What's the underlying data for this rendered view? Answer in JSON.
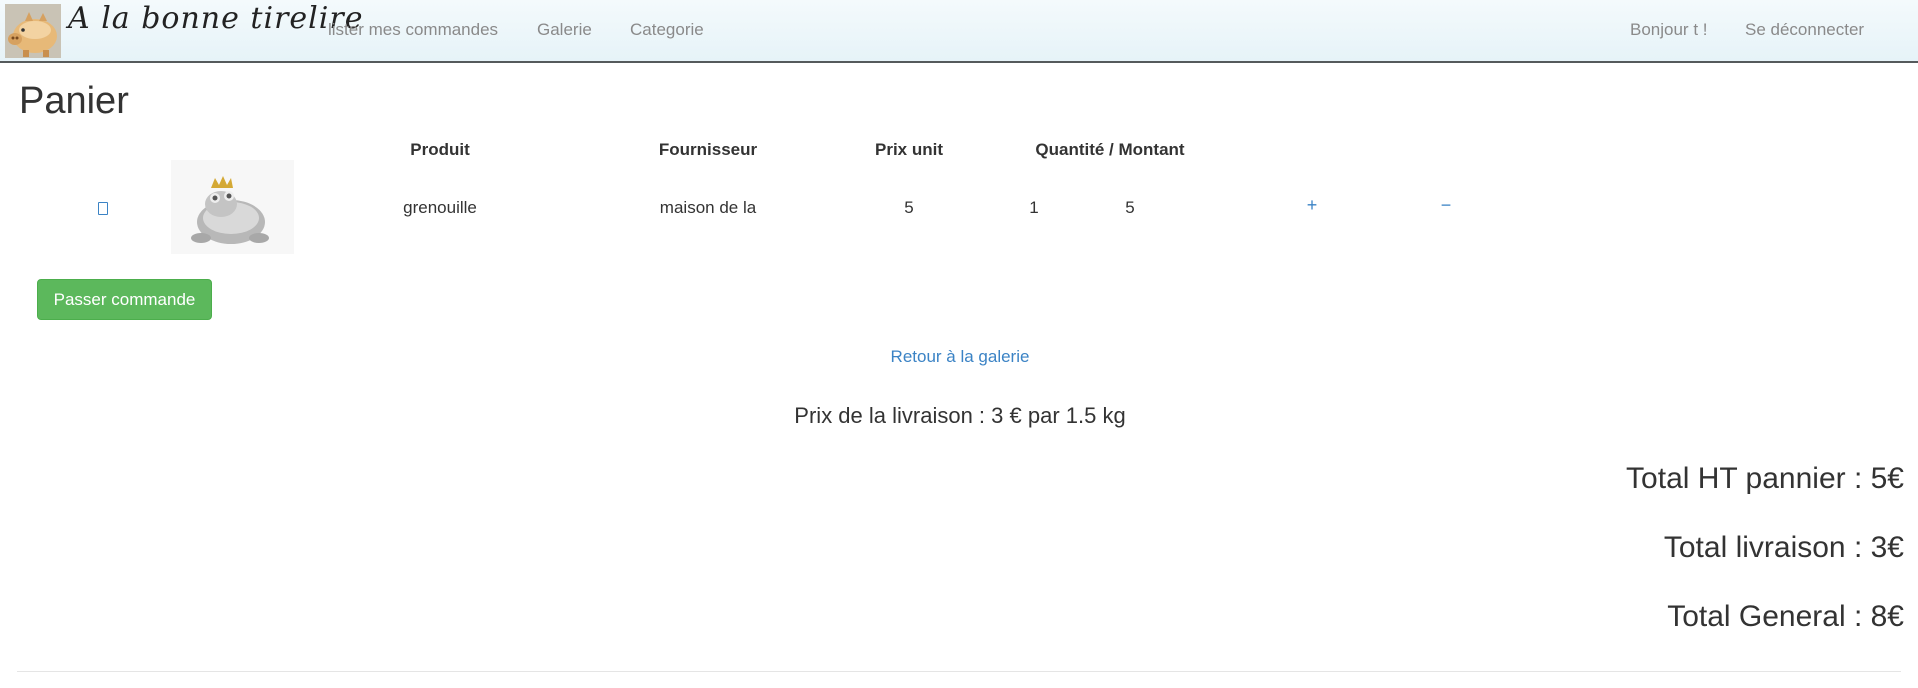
{
  "navbar": {
    "brand": "A la bonne tirelire",
    "logo_icon": "piggy-bank-icon",
    "links": [
      "lister mes commandes",
      "Galerie",
      "Categorie"
    ],
    "greeting": "Bonjour t !",
    "logout": "Se déconnecter"
  },
  "page": {
    "title": "Panier"
  },
  "cart": {
    "headers": {
      "product": "Produit",
      "supplier": "Fournisseur",
      "unit_price": "Prix unit",
      "qty_amount": "Quantité / Montant"
    },
    "rows": [
      {
        "remove_icon": "trash-icon",
        "image_icon": "frog-figurine-image",
        "product": "grenouille",
        "supplier": "maison de la",
        "unit_price": "5",
        "quantity": "1",
        "amount": "5",
        "increment": "+",
        "decrement": "−"
      }
    ]
  },
  "actions": {
    "order_button": "Passer commande",
    "back_link": "Retour à la galerie"
  },
  "delivery": {
    "info": "Prix de la livraison : 3 € par 1.5 kg"
  },
  "totals": {
    "subtotal": "Total HT pannier : 5€",
    "delivery": "Total livraison : 3€",
    "general": "Total General : 8€"
  },
  "colors": {
    "link": "#3b83c5",
    "button": "#5cb85c",
    "nav_text": "#8a8a8a"
  }
}
